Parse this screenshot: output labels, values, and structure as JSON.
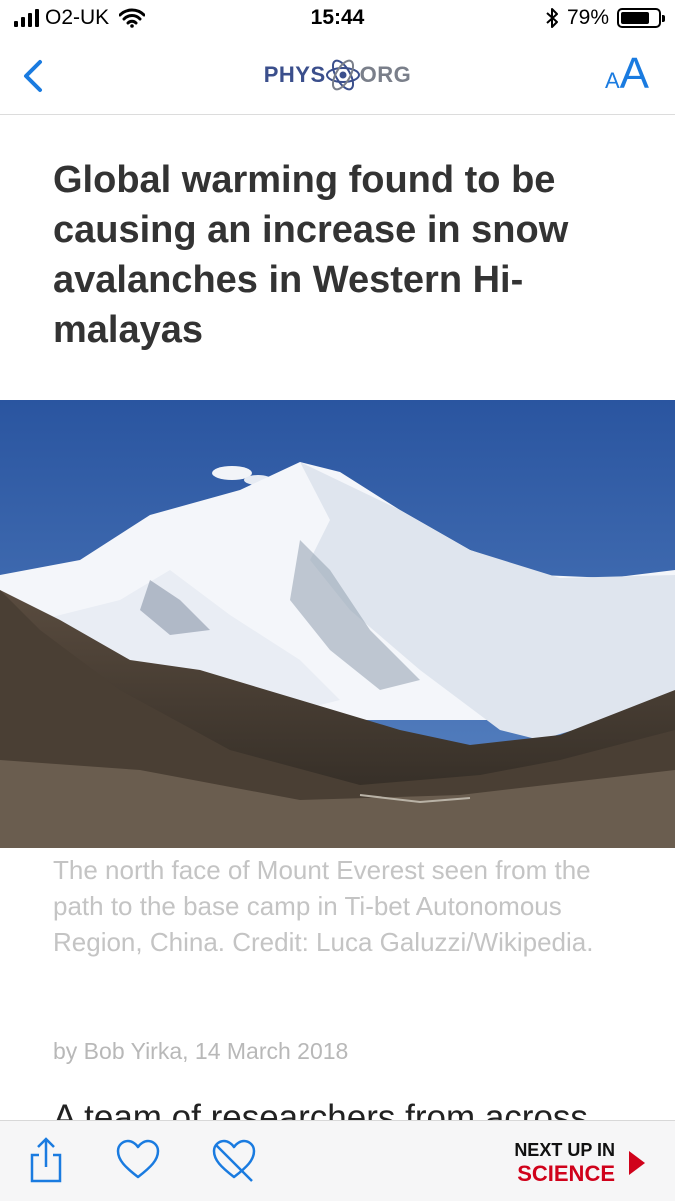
{
  "status_bar": {
    "carrier": "O2-UK",
    "time": "15:44",
    "battery_percent": "79%",
    "battery_level": 0.79,
    "signal_bars": 4,
    "icons": [
      "signal-bars-icon",
      "wifi-icon",
      "bluetooth-icon",
      "battery-icon"
    ]
  },
  "nav": {
    "back_icon": "chevron-left-icon",
    "logo_left": "PHYS",
    "logo_right": "ORG",
    "text_size_small": "A",
    "text_size_big": "A"
  },
  "article": {
    "headline": "Global warming found to be causing an increase in snow avalanches in Western Hi-malayas",
    "image_alt": "The north face of Mount Everest",
    "caption": "The north face of Mount Everest seen from the path to the base camp in Ti-bet Autonomous Region, China. Credit: Luca Galuzzi/Wikipedia.",
    "byline": "by Bob Yirka, 14 March 2018",
    "body_start": "A team of researchers from across"
  },
  "toolbar": {
    "share_icon": "share-icon",
    "like_icon": "heart-icon",
    "dislike_icon": "broken-heart-icon",
    "next_label": "NEXT UP IN",
    "next_section": "SCIENCE",
    "next_icon": "play-arrow-icon"
  },
  "colors": {
    "accent_blue": "#1a7be0",
    "science_red": "#d0021b",
    "caption_gray": "#c4c4c4"
  }
}
